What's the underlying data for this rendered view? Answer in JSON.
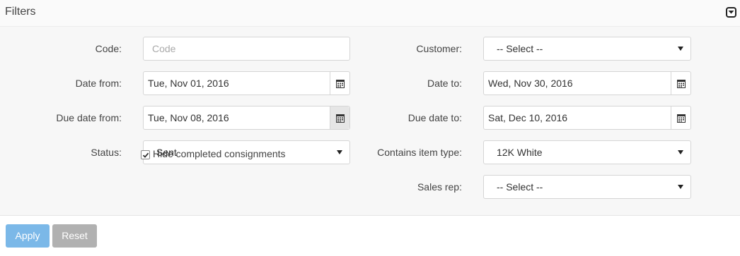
{
  "header": {
    "title": "Filters",
    "collapse_icon": "collapse-toggle-icon"
  },
  "left": {
    "code": {
      "label": "Code:",
      "value": "",
      "placeholder": "Code"
    },
    "date_from": {
      "label": "Date from:",
      "value": "Tue, Nov 01, 2016"
    },
    "due_date_from": {
      "label": "Due date from:",
      "value": "Tue, Nov 08, 2016"
    },
    "status": {
      "label": "Status:",
      "value": "Sent"
    },
    "hide_completed": {
      "label": "Hide completed consignments",
      "checked": true
    }
  },
  "right": {
    "customer": {
      "label": "Customer:",
      "value": "-- Select --"
    },
    "date_to": {
      "label": "Date to:",
      "value": "Wed, Nov 30, 2016"
    },
    "due_date_to": {
      "label": "Due date to:",
      "value": "Sat, Dec 10, 2016"
    },
    "item_type": {
      "label": "Contains item type:",
      "value": "12K White"
    },
    "sales_rep": {
      "label": "Sales rep:",
      "value": "-- Select --"
    }
  },
  "actions": {
    "apply_label": "Apply",
    "reset_label": "Reset"
  },
  "colors": {
    "apply": "#7bb8e8",
    "reset": "#b1b1b1",
    "body_bg": "#f7f7f7"
  }
}
